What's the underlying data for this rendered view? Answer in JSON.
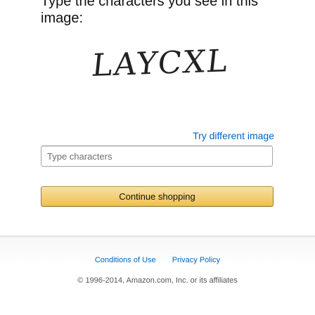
{
  "prompt": {
    "text": "Type the characters you see in this image:"
  },
  "captcha": {
    "text": "LAYCXL",
    "try_different_label": "Try different image"
  },
  "input": {
    "placeholder": "Type characters",
    "value": ""
  },
  "continue_button": {
    "label": "Continue shopping"
  },
  "footer": {
    "conditions_label": "Conditions of Use",
    "privacy_label": "Privacy Policy",
    "copyright": "© 1996-2014, Amazon.com, Inc. or its affiliates"
  },
  "colors": {
    "link": "#0066c0",
    "button_top": "#f7dfa5",
    "button_bottom": "#f0c14b"
  }
}
